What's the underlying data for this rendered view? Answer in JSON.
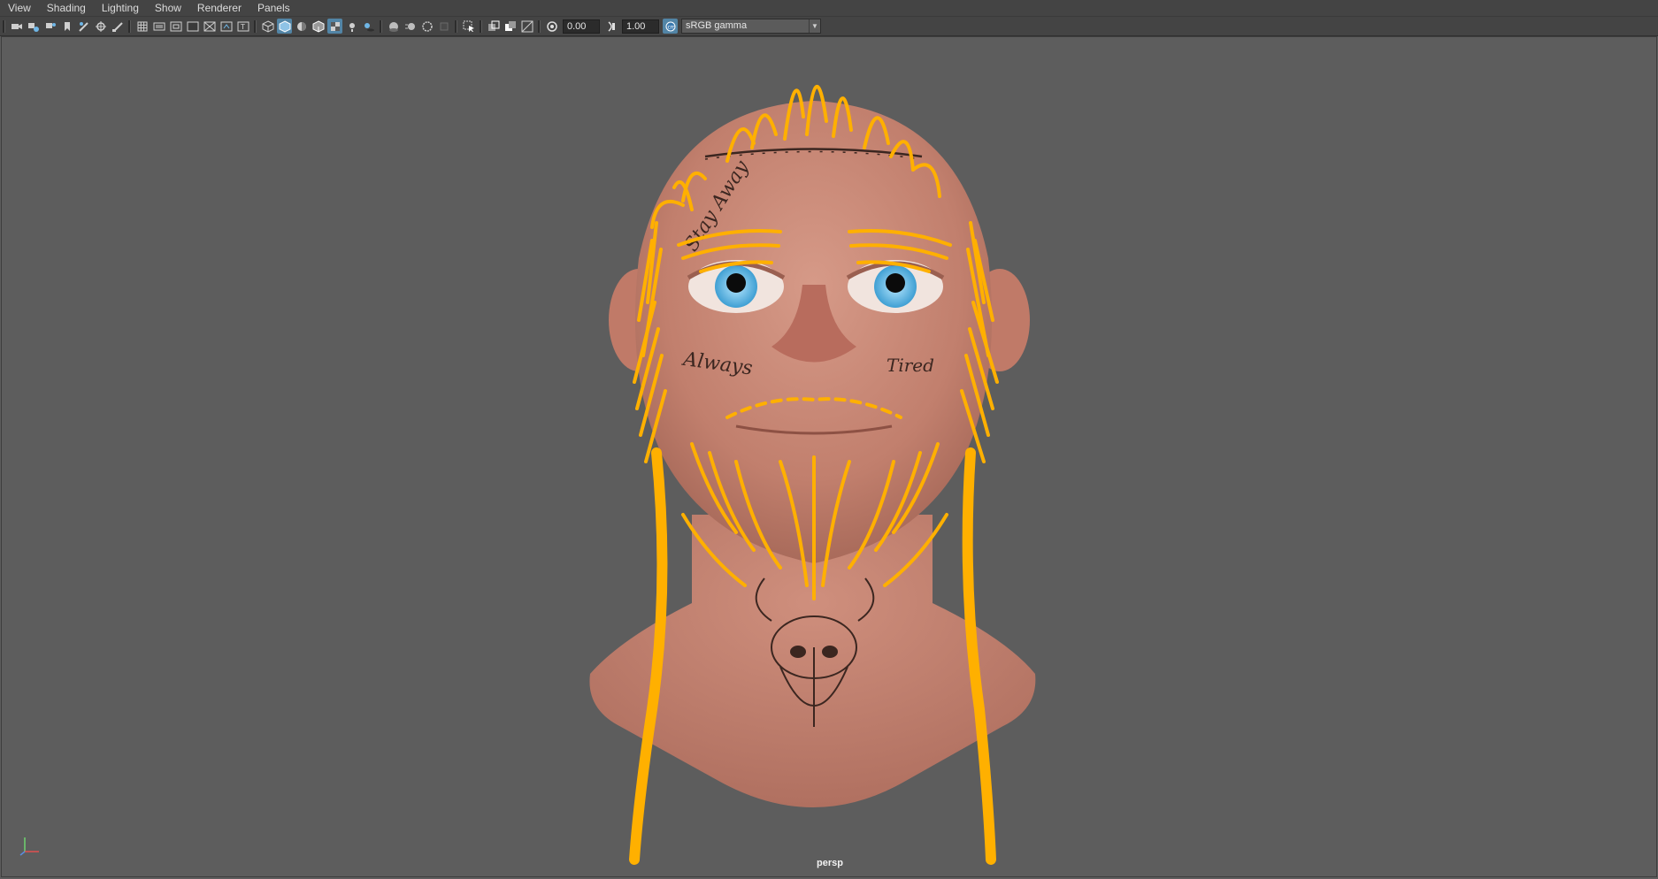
{
  "menu": [
    "View",
    "Shading",
    "Lighting",
    "Show",
    "Renderer",
    "Panels"
  ],
  "toolbar": {
    "exposure_value": "0.00",
    "gamma_value": "1.00",
    "color_space": "sRGB gamma",
    "icons_group1": [
      "camera-icon",
      "camera-attributes-icon",
      "bookmark-icon",
      "image-plane-icon",
      "grease-pencil-icon",
      "2d-pan-icon",
      "paint-icon"
    ],
    "icons_group2": [
      "grid-icon",
      "film-gate-icon",
      "resolution-gate-icon",
      "gate-mask-icon",
      "field-chart-icon",
      "safe-action-icon",
      "safe-title-icon"
    ],
    "icons_group3": [
      "wireframe-icon",
      "smooth-shade-icon",
      "default-material-icon",
      "wireframe-on-shaded-icon",
      "textured-icon",
      "lights-icon",
      "shadows-icon"
    ],
    "icons_group4": [
      "ambient-occlusion-icon",
      "motion-blur-icon",
      "anti-aliasing-icon",
      "depth-of-field-icon"
    ],
    "icons_group5": [
      "isolate-select-icon",
      "xray-icon",
      "xray-joints-icon",
      "xray-components-icon"
    ]
  },
  "viewport": {
    "camera": "persp",
    "accent_color": "#ffb000",
    "background_color": "#5d5d5d"
  },
  "scene_text": {
    "tattoo_forehead": "Stay Away",
    "tattoo_left_cheek": "Always",
    "tattoo_right_cheek": "Tired"
  }
}
